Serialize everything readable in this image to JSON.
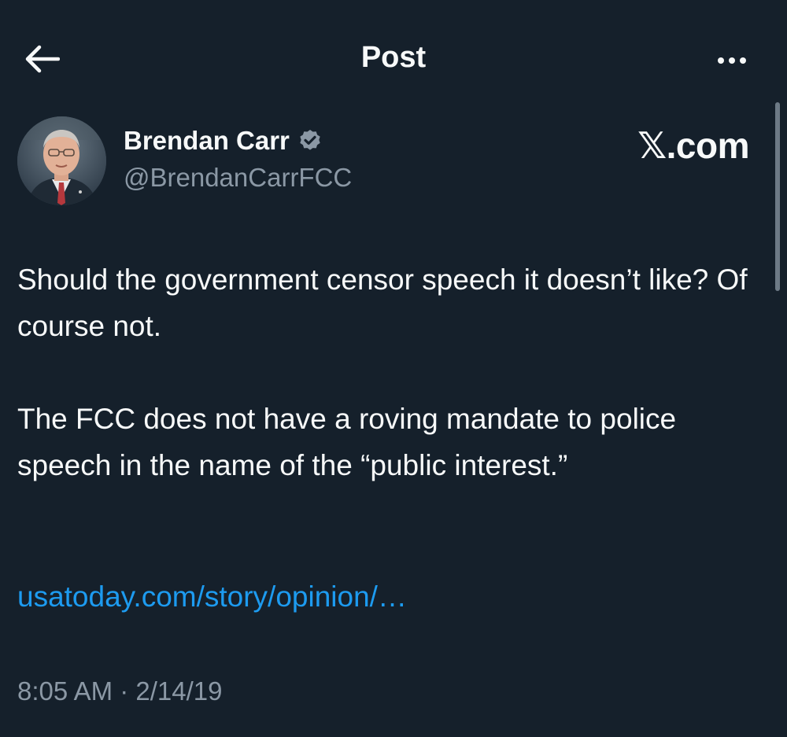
{
  "header": {
    "title": "Post",
    "back_icon": "arrow-left-icon",
    "more_icon": "more-horizontal-icon"
  },
  "author": {
    "name": "Brendan Carr",
    "handle": "@BrendanCarrFCC",
    "verified": true,
    "verified_color": "#8b98a5"
  },
  "brand": {
    "label": "𝕏.com"
  },
  "post": {
    "paragraph_1": "Should the government censor speech it doesn’t like?  Of course not.",
    "paragraph_2": "The FCC does not have a roving mandate to police speech in the name of the “public interest.”",
    "link_text": "usatoday.com/story/opinion/…",
    "timestamp": "8:05 AM · 2/14/19"
  },
  "colors": {
    "background": "#15202b",
    "text": "#f7f9f9",
    "muted": "#8b98a5",
    "link": "#1d9bf0"
  }
}
